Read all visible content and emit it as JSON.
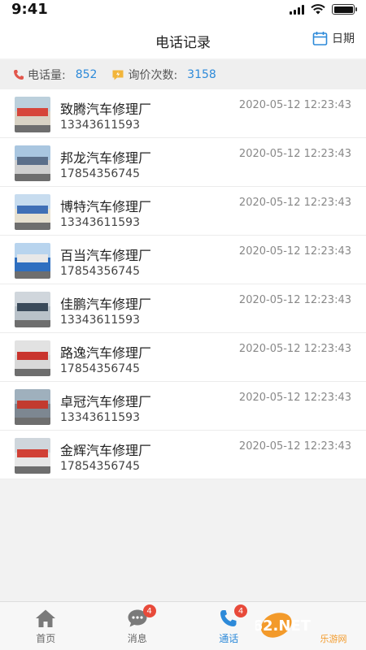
{
  "status_bar": {
    "time": "9:41"
  },
  "header": {
    "title": "电话记录",
    "date_label": "日期",
    "accent": "#2d8ad9"
  },
  "stats": {
    "calls_label": "电话量:",
    "calls_value": "852",
    "inquiries_label": "询价次数:",
    "inquiries_value": "3158"
  },
  "records": [
    {
      "name": "致腾汽车修理厂",
      "phone": "13343611593",
      "time": "2020-05-12 12:23:43"
    },
    {
      "name": "邦龙汽车修理厂",
      "phone": "17854356745",
      "time": "2020-05-12 12:23:43"
    },
    {
      "name": "博特汽车修理厂",
      "phone": "13343611593",
      "time": "2020-05-12 12:23:43"
    },
    {
      "name": "百当汽车修理厂",
      "phone": "17854356745",
      "time": "2020-05-12 12:23:43"
    },
    {
      "name": "佳鹏汽车修理厂",
      "phone": "13343611593",
      "time": "2020-05-12 12:23:43"
    },
    {
      "name": "路逸汽车修理厂",
      "phone": "17854356745",
      "time": "2020-05-12 12:23:43"
    },
    {
      "name": "卓冠汽车修理厂",
      "phone": "13343611593",
      "time": "2020-05-12 12:23:43"
    },
    {
      "name": "金辉汽车修理厂",
      "phone": "17854356745",
      "time": "2020-05-12 12:23:43"
    }
  ],
  "tabbar": {
    "home": "首页",
    "messages": "消息",
    "messages_badge": "4",
    "calls": "通话",
    "calls_badge": "4"
  },
  "watermark": {
    "text": "962.NET",
    "sub": "乐游网"
  }
}
